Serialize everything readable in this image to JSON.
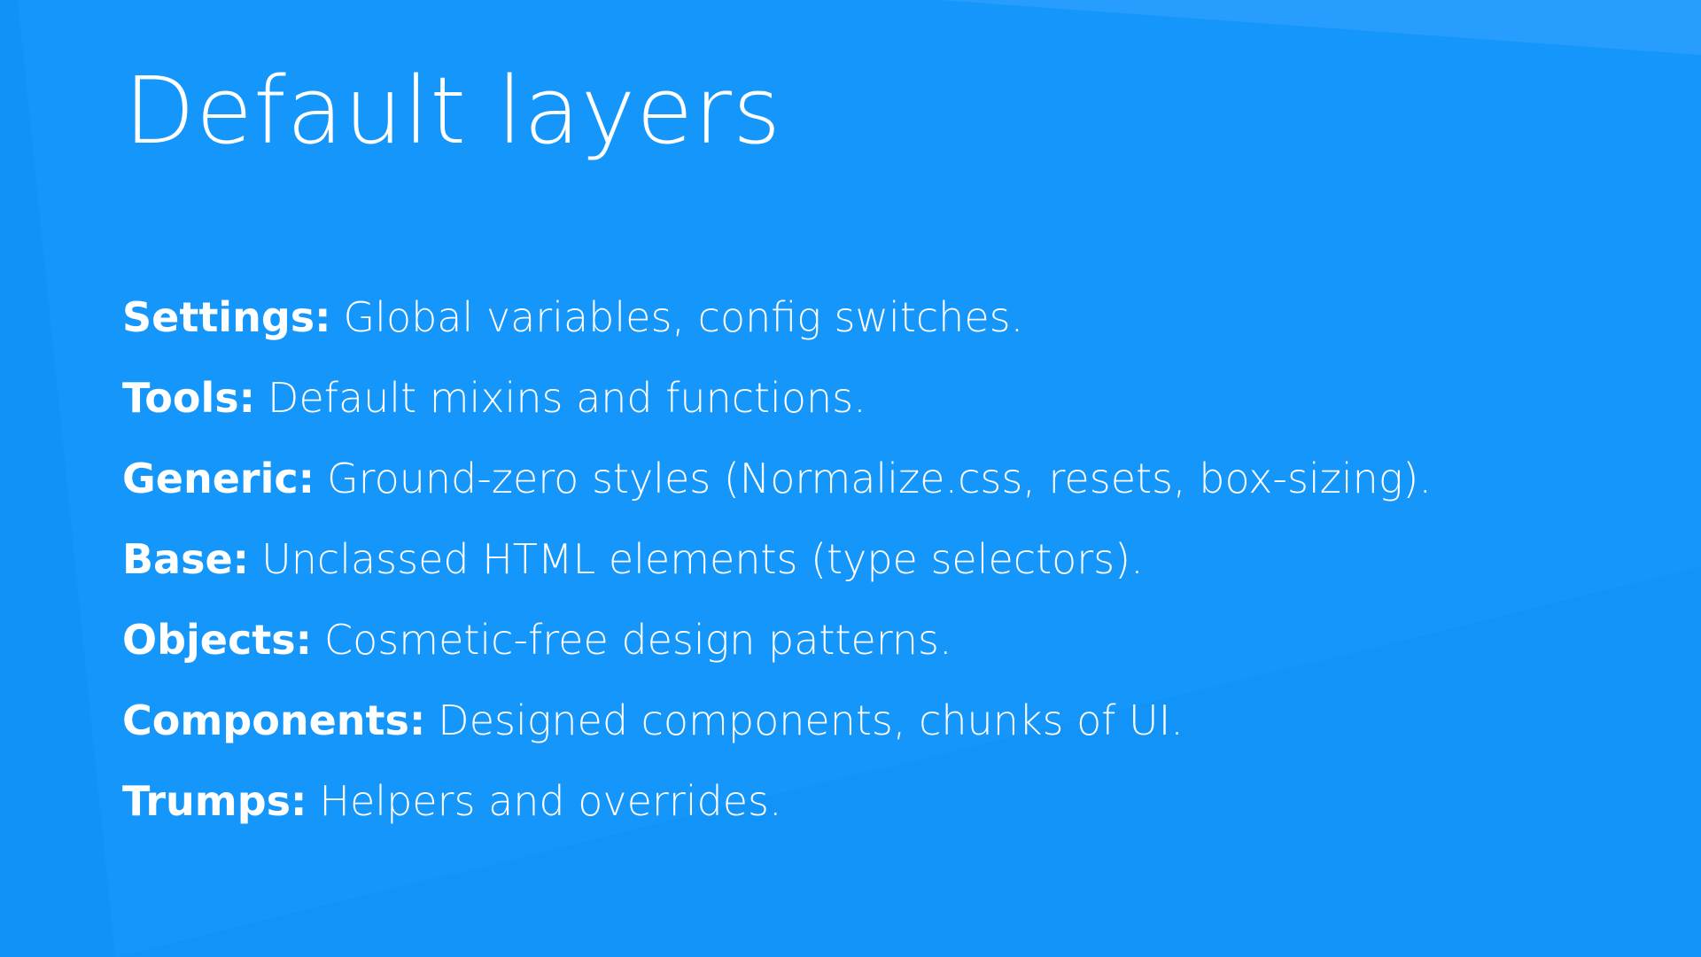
{
  "slide": {
    "title": "Default layers",
    "layers": [
      {
        "term": "Settings:",
        "description": "Global variables, config switches."
      },
      {
        "term": "Tools:",
        "description": "Default mixins and functions."
      },
      {
        "term": "Generic:",
        "description": "Ground-zero styles (Normalize.css, resets, box-sizing)."
      },
      {
        "term": "Base:",
        "description": "Unclassed HTML elements (type selectors)."
      },
      {
        "term": "Objects:",
        "description": "Cosmetic-free design patterns."
      },
      {
        "term": "Components:",
        "description": "Designed components, chunks of UI."
      },
      {
        "term": "Trumps:",
        "description": "Helpers and overrides."
      }
    ]
  },
  "colors": {
    "background": "#1496fb",
    "text": "#ffffff"
  }
}
